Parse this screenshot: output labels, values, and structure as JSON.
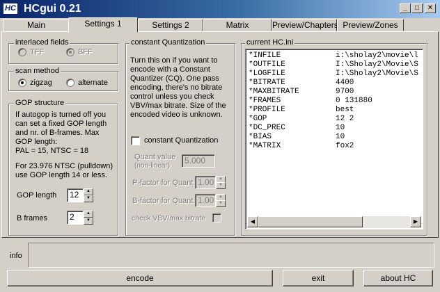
{
  "window": {
    "title": "HCgui 0.21",
    "icon_text": "HC",
    "controls": {
      "minimize": "_",
      "maximize": "□",
      "close": "✕"
    }
  },
  "tabs": [
    {
      "label": "Main",
      "active": false
    },
    {
      "label": "Settings 1",
      "active": true
    },
    {
      "label": "Settings 2",
      "active": false
    },
    {
      "label": "Matrix",
      "active": false
    },
    {
      "label": "Preview/Chapters",
      "active": false
    },
    {
      "label": "Preview/Zones",
      "active": false
    }
  ],
  "interlaced": {
    "title": "interlaced fields",
    "opt1": "TFF",
    "opt2": "BFF",
    "selected": "BFF"
  },
  "scan": {
    "title": "scan method",
    "opt1": "zigzag",
    "opt2": "alternate",
    "selected": "zigzag"
  },
  "gop": {
    "title": "GOP structure",
    "desc_lines": [
      "If autogop is turned off you",
      "can set a fixed GOP length",
      "and nr. of B-frames.  Max",
      "GOP length:",
      "PAL = 15, NTSC = 18"
    ],
    "ntsc_lines": [
      "For 23.976 NTSC (pulldown)",
      "use GOP length 14 or less."
    ],
    "length_label": "GOP length",
    "length_value": "12",
    "bframes_label": "B frames",
    "bframes_value": "2"
  },
  "cq": {
    "title": "constant Quantization",
    "desc_lines": [
      "Turn this on if you want to",
      "encode with a Constant",
      "Quantizer (CQ).  One pass",
      "encoding, there's no bitrate",
      "control unless you check",
      "VBV/max bitrate.  Size of the",
      "encoded video is unknown."
    ],
    "checkbox_label": "constant Quantization",
    "quant_label": "Quant value",
    "quant_sublabel": "(non-linear)",
    "quant_value": "5.000",
    "pfactor_label": "P-factor for Quant",
    "pfactor_value": "1.00",
    "bfactor_label": "B-factor for Quant",
    "bfactor_value": "1.00",
    "vbv_label": "check VBV/max bitrate"
  },
  "ini": {
    "title": "current HC.ini",
    "rows": [
      {
        "key": "*INFILE",
        "value": "i:\\sholay2\\movie\\l"
      },
      {
        "key": "*OUTFILE",
        "value": "I:\\Sholay2\\Movie\\S"
      },
      {
        "key": "*LOGFILE",
        "value": "I:\\Sholay2\\Movie\\S"
      },
      {
        "key": "*BITRATE",
        "value": "4400"
      },
      {
        "key": "*MAXBITRATE",
        "value": "9700"
      },
      {
        "key": "*FRAMES",
        "value": "0 131880"
      },
      {
        "key": "*PROFILE",
        "value": "best"
      },
      {
        "key": "*GOP",
        "value": "12 2"
      },
      {
        "key": "*DC_PREC",
        "value": "10"
      },
      {
        "key": "*BIAS",
        "value": "10"
      },
      {
        "key": "*MATRIX",
        "value": "fox2"
      }
    ]
  },
  "info_label": "info",
  "buttons": {
    "encode": "encode",
    "exit": "exit",
    "about": "about HC"
  }
}
